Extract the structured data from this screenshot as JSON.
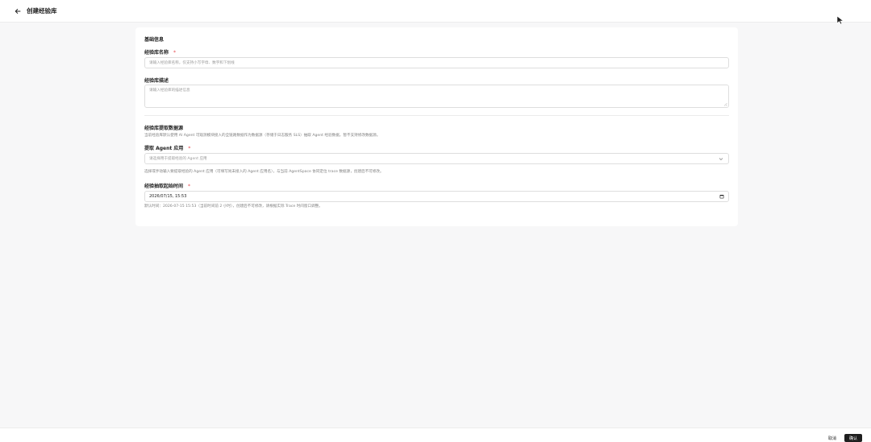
{
  "header": {
    "title": "创建经验库"
  },
  "form": {
    "basic_section_title": "基础信息",
    "name_label": "经验库名称",
    "required_mark": "*",
    "name_placeholder": "请输入经验库名称，仅支持小写字母、数字和下划线",
    "desc_label": "经验库描述",
    "desc_placeholder": "请输入经验库的描述信息",
    "source_section_title": "经验库提取数据源",
    "source_help": "当前经验库默认使用 AI Agent 可观测模块接入的全链路数据作为数据源（存储于日志服务 SLS）抽取 Agent 经验数据，暂不支持修改数据源。",
    "agent_label": "提取 Agent 应用",
    "agent_placeholder": "请选择用于提取经验的 Agent 应用",
    "agent_help": "选择或手动输入要提取经验的 Agent 应用（可填写尚未接入的 Agent 应用名），与当前 AgentSpace 协同定位 trace 数据源，创建后不可修改。",
    "time_label": "经验抽取起始时间",
    "time_value": "2026/07/15, 15:53",
    "time_help": "默认时间：2026-07-15 15:53（当前时间前 2 小时），创建后不可修改，请根据实际 Trace 时间窗口调整。"
  },
  "footer": {
    "cancel_label": "取消",
    "confirm_label": "确认"
  }
}
